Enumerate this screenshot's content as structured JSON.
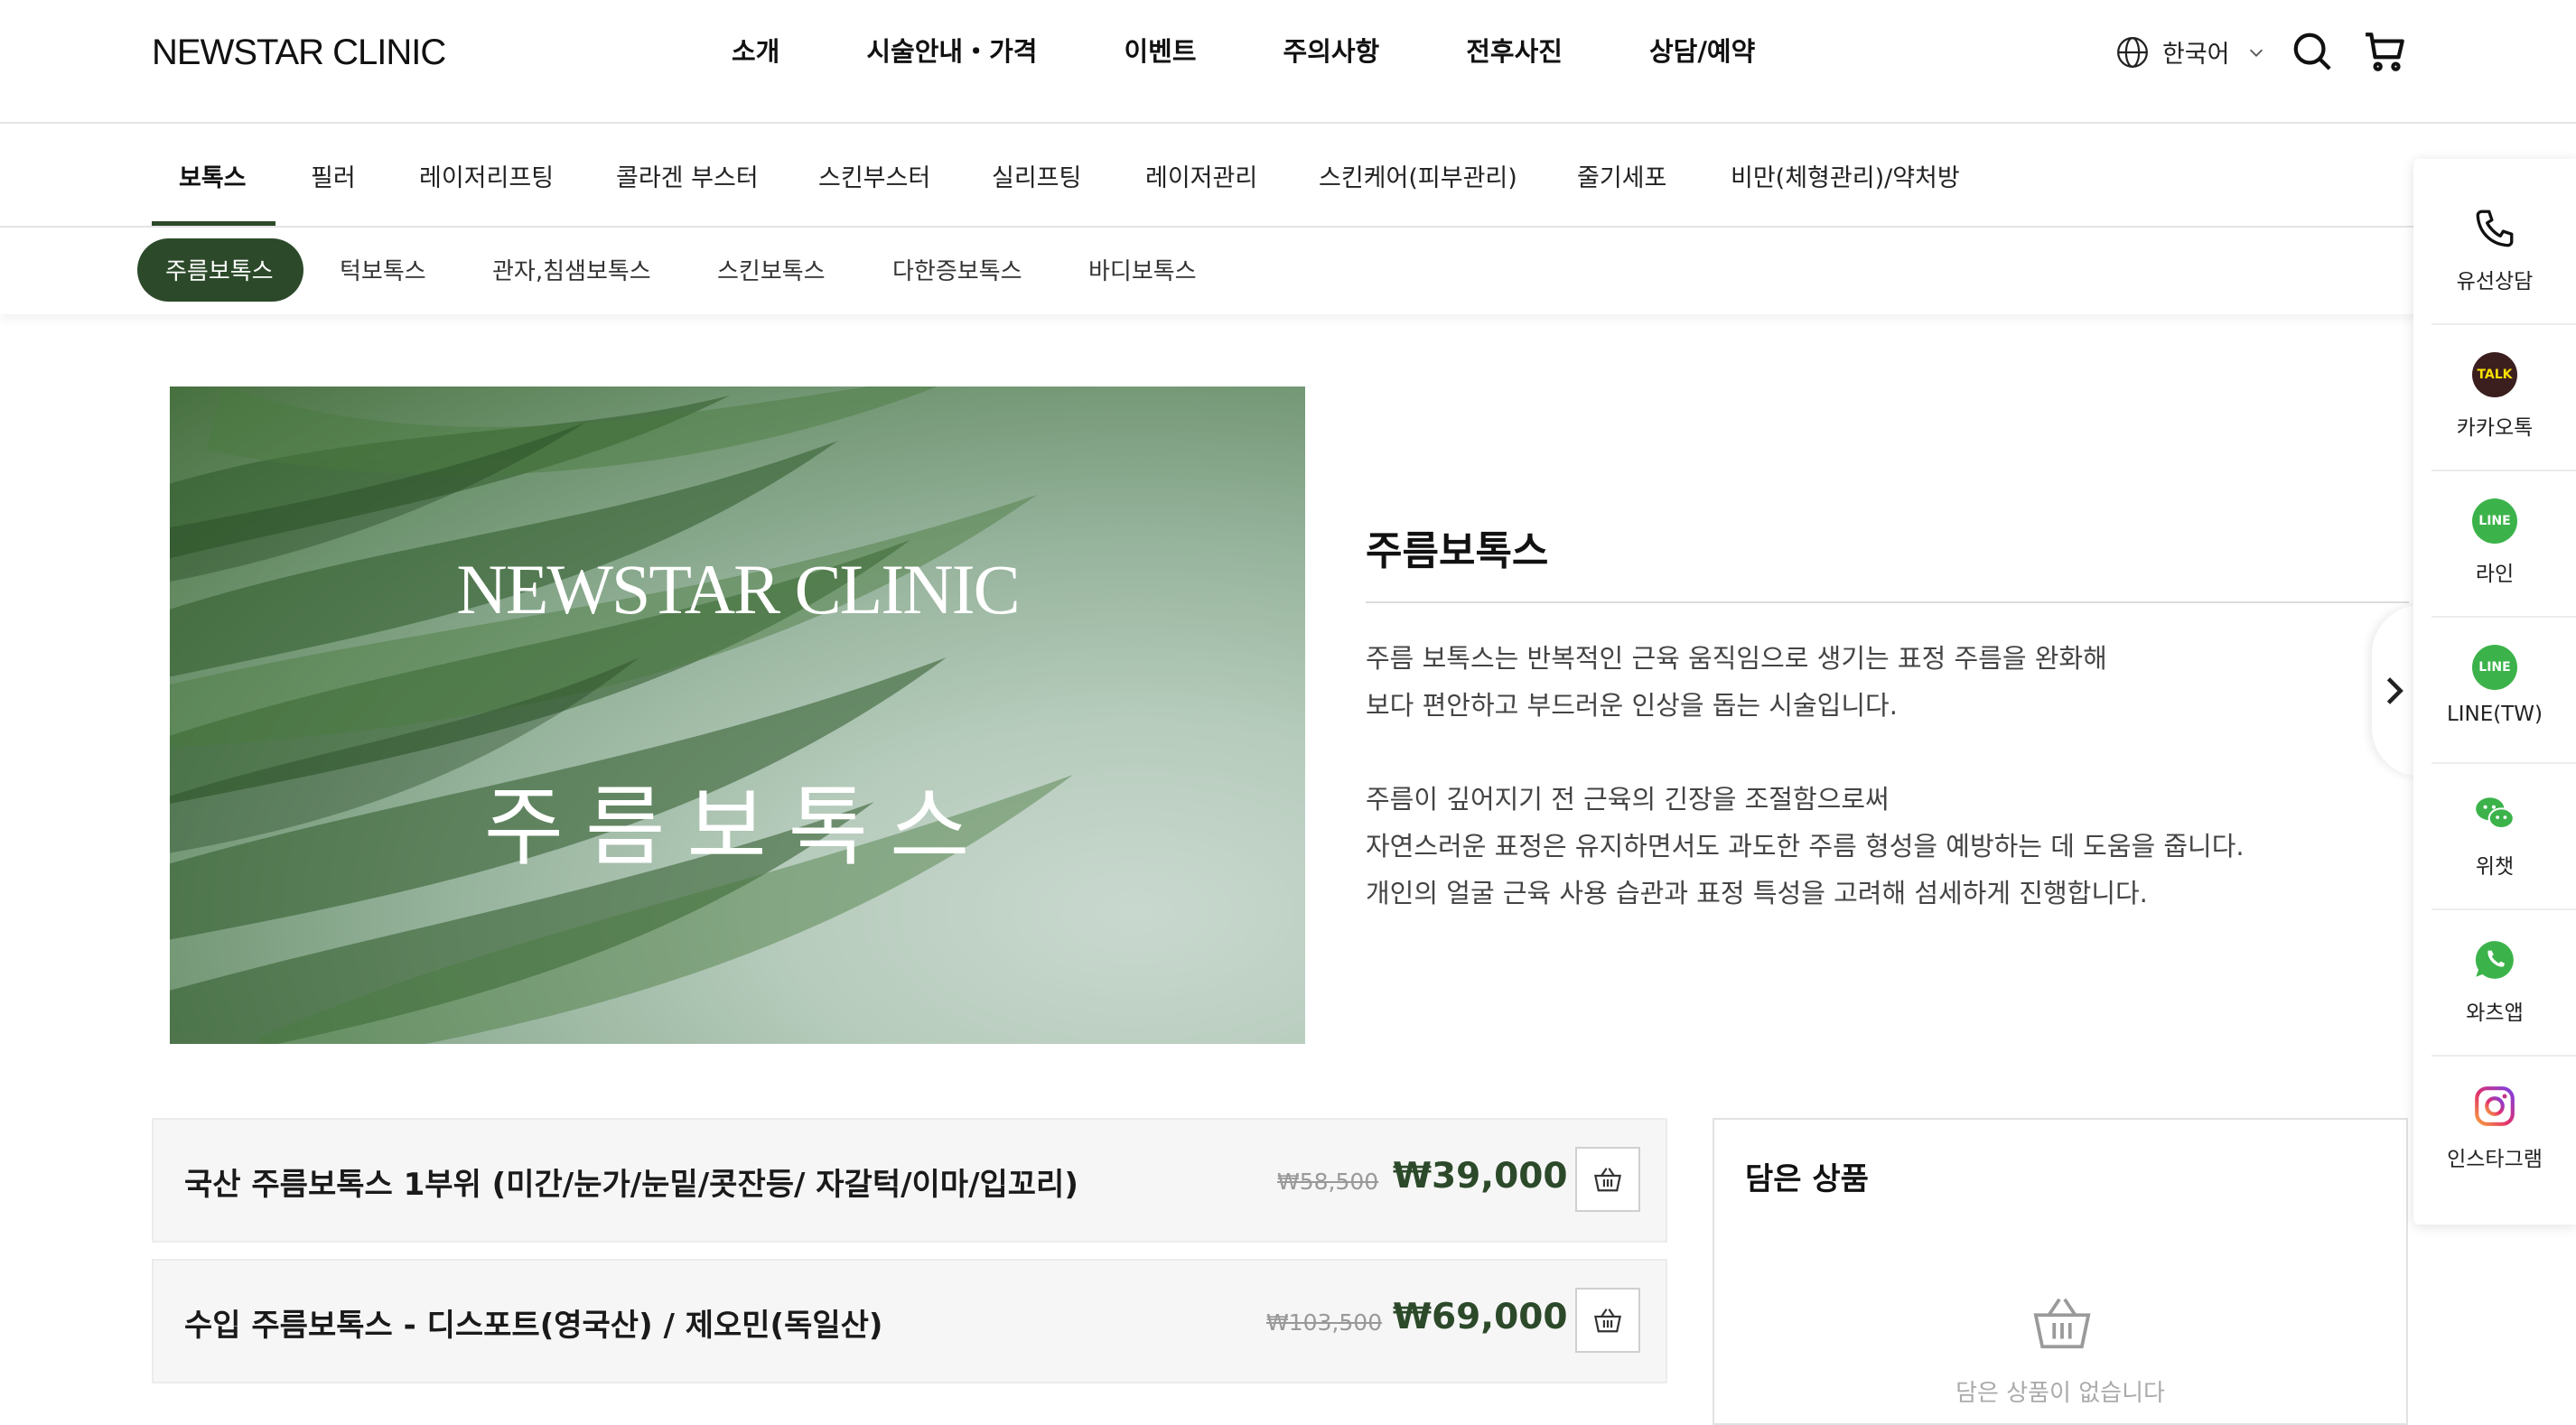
{
  "header": {
    "logo": "NEWSTAR CLINIC",
    "nav": [
      "소개",
      "시술안내・가격",
      "이벤트",
      "주의사항",
      "전후사진",
      "상담/예약"
    ],
    "language": "한국어",
    "icons": [
      "globe-icon",
      "chevron-down-icon",
      "search-icon",
      "cart-icon"
    ]
  },
  "category_nav": {
    "items": [
      "보톡스",
      "필러",
      "레이저리프팅",
      "콜라겐 부스터",
      "스킨부스터",
      "실리프팅",
      "레이저관리",
      "스킨케어(피부관리)",
      "줄기세포",
      "비만(체형관리)/약처방"
    ],
    "active": "보톡스"
  },
  "sub_nav": {
    "items": [
      "주름보톡스",
      "턱보톡스",
      "관자,침샘보톡스",
      "스킨보톡스",
      "다한증보톡스",
      "바디보톡스"
    ],
    "active": "주름보톡스"
  },
  "hero": {
    "brand": "NEWSTAR CLINIC",
    "title": "주름보톡스"
  },
  "description": {
    "title": "주름보톡스",
    "lines": [
      "주름 보톡스는 반복적인 근육 움직임으로 생기는 표정 주름을 완화해",
      "보다 편안하고 부드러운 인상을 돕는 시술입니다.",
      "주름이 깊어지기 전 근육의 긴장을 조절함으로써",
      "자연스러운 표정은 유지하면서도 과도한 주름 형성을 예방하는 데 도움을 줍니다.",
      "개인의 얼굴 근육 사용 습관과 표정 특성을 고려해 섬세하게 진행합니다."
    ]
  },
  "products": [
    {
      "name": "국산 주름보톡스 1부위 (미간/눈가/눈밑/콧잔등/ 자갈턱/이마/입꼬리)",
      "original_price": "₩58,500",
      "price": "₩39,000"
    },
    {
      "name": "수입 주름보톡스 - 디스포트(영국산) / 제오민(독일산)",
      "original_price": "₩103,500",
      "price": "₩69,000"
    }
  ],
  "cart": {
    "title": "담은 상품",
    "empty_message": "담은 상품이 없습니다"
  },
  "side_bar": {
    "items": [
      {
        "label": "유선상담",
        "icon": "phone-icon"
      },
      {
        "label": "카카오톡",
        "icon": "kakaotalk-icon",
        "badge": "TALK"
      },
      {
        "label": "라인",
        "icon": "line-icon",
        "badge": "LINE"
      },
      {
        "label": "LINE(TW)",
        "icon": "line-tw-icon",
        "badge": "LINE"
      },
      {
        "label": "위챗",
        "icon": "wechat-icon"
      },
      {
        "label": "와츠앱",
        "icon": "whatsapp-icon"
      },
      {
        "label": "인스타그램",
        "icon": "instagram-icon"
      }
    ]
  },
  "colors": {
    "brand_green": "#2c4a2a",
    "line_green": "#3cb34a",
    "kakao_dark": "#3b1e1e",
    "kakao_yellow": "#f9e000"
  }
}
